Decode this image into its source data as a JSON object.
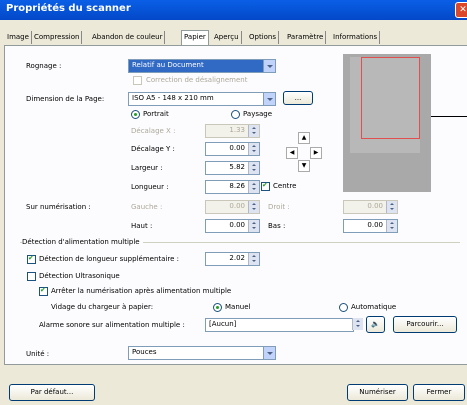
{
  "window": {
    "title": "Propriétés du scanner",
    "close": "✕"
  },
  "tabs": [
    "Image",
    "Compression",
    "Abandon de couleur",
    "Papier",
    "Aperçu",
    "Options",
    "Paramètre",
    "Informations"
  ],
  "active_tab": "Papier",
  "paper": {
    "cropping_label": "Rognage :",
    "cropping_value": "Relatif au Document",
    "deskew_label": "Correction de désalignement",
    "page_size_label": "Dimension de la Page:",
    "page_size_value": "ISO A5 - 148 x 210 mm",
    "browse_small": "...",
    "orientation_portrait": "Portrait",
    "orientation_landscape": "Paysage",
    "offset_x_label": "Décalage X :",
    "offset_x_value": "1.33",
    "offset_y_label": "Décalage Y :",
    "offset_y_value": "0.00",
    "width_label": "Largeur :",
    "width_value": "5.82",
    "length_label": "Longueur :",
    "length_value": "8.26",
    "center_label": "Centre",
    "overscan_label": "Sur numérisation :",
    "left_label": "Gauche :",
    "left_value": "0.00",
    "right_label": "Droit :",
    "right_value": "0.00",
    "top_label": "Haut :",
    "top_value": "0.00",
    "bottom_label": "Bas :",
    "bottom_value": "0.00"
  },
  "multifeed": {
    "group_title": "Détection d'alimentation multiple",
    "length_detect_label": "Détection de longueur supplémentaire :",
    "length_detect_value": "2.02",
    "ultrasonic_label": "Détection Ultrasonique",
    "stop_label": "Arrêter la numérisation après alimentation multiple",
    "empty_feeder_label": "Vidage du chargeur à papier:",
    "manual_label": "Manuel",
    "auto_label": "Automatique",
    "alarm_label": "Alarme sonore sur alimentation multiple :",
    "alarm_value": "[Aucun]",
    "browse_label": "Parcourir..."
  },
  "unit": {
    "label": "Unité :",
    "value": "Pouces"
  },
  "footer": {
    "default": "Par défaut...",
    "scan": "Numériser",
    "close": "Fermer"
  }
}
